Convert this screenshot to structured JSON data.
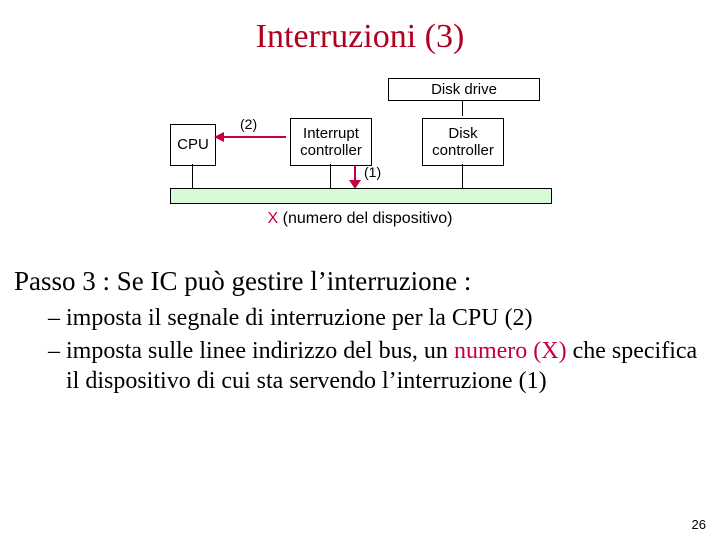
{
  "title": "Interruzioni (3)",
  "diagram": {
    "disk_drive_label": "Disk drive",
    "cpu": "CPU",
    "interrupt_controller_l1": "Interrupt",
    "interrupt_controller_l2": "controller",
    "disk_controller_l1": "Disk",
    "disk_controller_l2": "controller",
    "label_two": "(2)",
    "label_one": "(1)",
    "bus_caption_x": "X ",
    "bus_caption_rest": "(numero del dispositivo)"
  },
  "text": {
    "passo": "Passo 3 : Se IC può gestire l’interruzione :",
    "b1_dash": "– ",
    "b1": "imposta il segnale di interruzione per la CPU (2)",
    "b2_dash": "– ",
    "b2_a": "imposta sulle linee indirizzo del bus, un ",
    "b2_num": "numero (X)",
    "b2_b": " che specifica il dispositivo di cui sta servendo l’interruzione (1)"
  },
  "page_number": "26"
}
